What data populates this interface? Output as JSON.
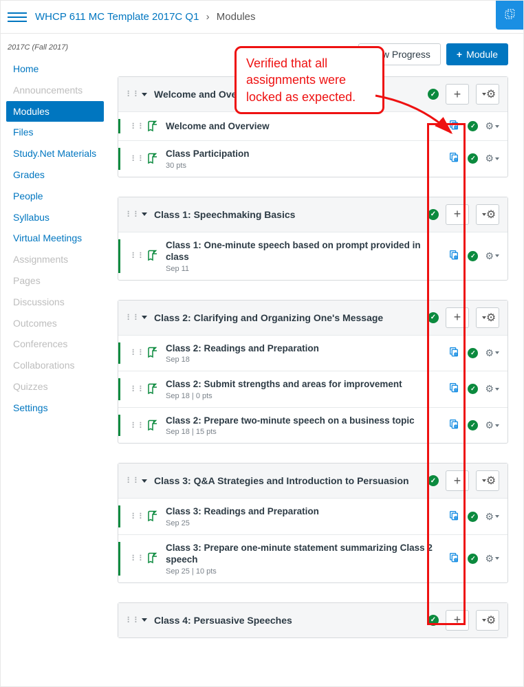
{
  "breadcrumb": {
    "course": "WHCP 611 MC Template 2017C Q1",
    "current": "Modules"
  },
  "term": "2017C (Fall 2017)",
  "nav": [
    {
      "label": "Home",
      "state": "on"
    },
    {
      "label": "Announcements",
      "state": "off"
    },
    {
      "label": "Modules",
      "state": "active"
    },
    {
      "label": "Files",
      "state": "on"
    },
    {
      "label": "Study.Net Materials",
      "state": "on"
    },
    {
      "label": "Grades",
      "state": "on"
    },
    {
      "label": "People",
      "state": "on"
    },
    {
      "label": "Syllabus",
      "state": "on"
    },
    {
      "label": "Virtual Meetings",
      "state": "on"
    },
    {
      "label": "Assignments",
      "state": "off"
    },
    {
      "label": "Pages",
      "state": "off"
    },
    {
      "label": "Discussions",
      "state": "off"
    },
    {
      "label": "Outcomes",
      "state": "off"
    },
    {
      "label": "Conferences",
      "state": "off"
    },
    {
      "label": "Collaborations",
      "state": "off"
    },
    {
      "label": "Quizzes",
      "state": "off"
    },
    {
      "label": "Settings",
      "state": "on"
    }
  ],
  "buttons": {
    "view_progress": "View Progress",
    "add_module": "Module"
  },
  "annotation": "Verified that all assignments were locked as expected.",
  "modules": [
    {
      "title": "Welcome and Overview",
      "items": [
        {
          "title": "Welcome and Overview",
          "meta": ""
        },
        {
          "title": "Class Participation",
          "meta": "30 pts"
        }
      ]
    },
    {
      "title": "Class 1: Speechmaking Basics",
      "items": [
        {
          "title": "Class 1: One-minute speech based on prompt provided in class",
          "meta": "Sep 11"
        }
      ]
    },
    {
      "title": "Class 2: Clarifying and Organizing One's Message",
      "items": [
        {
          "title": "Class 2: Readings and Preparation",
          "meta": "Sep 18"
        },
        {
          "title": "Class 2: Submit strengths and areas for improvement",
          "meta": "Sep 18  |  0 pts"
        },
        {
          "title": "Class 2: Prepare two-minute speech on a business topic",
          "meta": "Sep 18  |  15 pts"
        }
      ]
    },
    {
      "title": "Class 3: Q&A Strategies and Introduction to Persuasion",
      "items": [
        {
          "title": "Class 3: Readings and Preparation",
          "meta": "Sep 25"
        },
        {
          "title": "Class 3: Prepare one-minute statement summarizing Class 2 speech",
          "meta": "Sep 25  |  10 pts"
        }
      ]
    },
    {
      "title": "Class 4: Persuasive Speeches",
      "items": []
    }
  ]
}
